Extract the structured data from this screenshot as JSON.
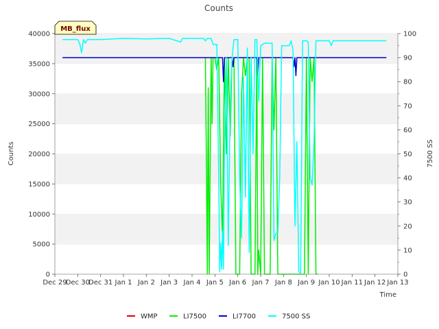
{
  "chart_data": {
    "type": "line",
    "title": "Counts",
    "xlabel": "Time",
    "ylabel": "Counts",
    "ylabel_right": "7500 SS",
    "badge": "MB_flux",
    "x_range": [
      "2023-12-29",
      "2024-01-13"
    ],
    "x_ticks": [
      {
        "date": "2023-12-29",
        "label": "Dec 29"
      },
      {
        "date": "2023-12-30",
        "label": "Dec 30"
      },
      {
        "date": "2023-12-31",
        "label": "Dec 31"
      },
      {
        "date": "2024-01-01",
        "label": "Jan 1"
      },
      {
        "date": "2024-01-02",
        "label": "Jan 2"
      },
      {
        "date": "2024-01-03",
        "label": "Jan 3"
      },
      {
        "date": "2024-01-04",
        "label": "Jan 4"
      },
      {
        "date": "2024-01-05",
        "label": "Jan 5"
      },
      {
        "date": "2024-01-06",
        "label": "Jan 6"
      },
      {
        "date": "2024-01-07",
        "label": "Jan 7"
      },
      {
        "date": "2024-01-08",
        "label": "Jan 8"
      },
      {
        "date": "2024-01-09",
        "label": "Jan 9"
      },
      {
        "date": "2024-01-10",
        "label": "Jan 10"
      },
      {
        "date": "2024-01-11",
        "label": "Jan 11"
      },
      {
        "date": "2024-01-12",
        "label": "Jan 12"
      },
      {
        "date": "2024-01-13",
        "label": "Jan 13"
      }
    ],
    "ylim": [
      0,
      40000
    ],
    "y_ticks": [
      0,
      5000,
      10000,
      15000,
      20000,
      25000,
      30000,
      35000,
      40000
    ],
    "ylim_right": [
      0,
      100
    ],
    "y_ticks_right": [
      0,
      10,
      20,
      30,
      40,
      50,
      60,
      70,
      80,
      90,
      100
    ],
    "grid": "horizontal bands",
    "legend_position": "bottom",
    "series": [
      {
        "name": "WMP",
        "color": "#dd0000",
        "axis": "left",
        "points": []
      },
      {
        "name": "LI7500",
        "color": "#00ee00",
        "axis": "left",
        "points": [
          [
            "2024-01-04 14:00",
            36000
          ],
          [
            "2024-01-04 15:00",
            20000
          ],
          [
            "2024-01-04 16:00",
            0
          ],
          [
            "2024-01-04 17:00",
            31000
          ],
          [
            "2024-01-04 18:00",
            0
          ],
          [
            "2024-01-04 20:00",
            36000
          ],
          [
            "2024-01-04 21:00",
            25000
          ],
          [
            "2024-01-04 22:00",
            36000
          ],
          [
            "2024-01-05 00:00",
            36000
          ],
          [
            "2024-01-05 02:00",
            34000
          ],
          [
            "2024-01-05 04:00",
            36000
          ],
          [
            "2024-01-05 06:00",
            15000
          ],
          [
            "2024-01-05 08:00",
            6000
          ],
          [
            "2024-01-05 10:00",
            36000
          ],
          [
            "2024-01-05 12:00",
            20000
          ],
          [
            "2024-01-05 14:00",
            36000
          ],
          [
            "2024-01-05 16:00",
            23000
          ],
          [
            "2024-01-05 18:00",
            36000
          ],
          [
            "2024-01-05 20:00",
            36000
          ],
          [
            "2024-01-05 22:00",
            0
          ],
          [
            "2024-01-06 00:00",
            0
          ],
          [
            "2024-01-06 02:00",
            0
          ],
          [
            "2024-01-06 04:00",
            30000
          ],
          [
            "2024-01-06 06:00",
            36000
          ],
          [
            "2024-01-06 08:00",
            33000
          ],
          [
            "2024-01-06 10:00",
            36000
          ],
          [
            "2024-01-06 12:00",
            36000
          ],
          [
            "2024-01-06 14:00",
            0
          ],
          [
            "2024-01-06 16:00",
            0
          ],
          [
            "2024-01-06 18:00",
            0
          ],
          [
            "2024-01-06 20:00",
            36000
          ],
          [
            "2024-01-06 21:00",
            0
          ],
          [
            "2024-01-06 22:00",
            4000
          ],
          [
            "2024-01-07 00:00",
            0
          ],
          [
            "2024-01-07 02:00",
            36000
          ],
          [
            "2024-01-07 04:00",
            0
          ],
          [
            "2024-01-07 10:00",
            0
          ],
          [
            "2024-01-07 12:00",
            36000
          ],
          [
            "2024-01-07 14:00",
            24000
          ],
          [
            "2024-01-07 16:00",
            36000
          ],
          [
            "2024-01-07 18:00",
            0
          ],
          [
            "2024-01-08 22:00",
            0
          ],
          [
            "2024-01-09 00:00",
            36000
          ],
          [
            "2024-01-09 02:00",
            0
          ],
          [
            "2024-01-09 04:00",
            36000
          ],
          [
            "2024-01-09 06:00",
            32000
          ],
          [
            "2024-01-09 08:00",
            36000
          ],
          [
            "2024-01-09 10:00",
            0
          ],
          [
            "2024-01-09 12:00",
            0
          ]
        ]
      },
      {
        "name": "LI7700",
        "color": "#0000cc",
        "axis": "left",
        "points": [
          [
            "2023-12-29 08:00",
            36000
          ],
          [
            "2024-01-05 08:00",
            36000
          ],
          [
            "2024-01-05 09:00",
            32000
          ],
          [
            "2024-01-05 10:00",
            36000
          ],
          [
            "2024-01-05 18:00",
            36000
          ],
          [
            "2024-01-05 19:00",
            34500
          ],
          [
            "2024-01-05 20:00",
            36000
          ],
          [
            "2024-01-06 20:00",
            36000
          ],
          [
            "2024-01-06 21:00",
            33000
          ],
          [
            "2024-01-06 22:00",
            36000
          ],
          [
            "2024-01-08 10:00",
            36000
          ],
          [
            "2024-01-08 11:00",
            34500
          ],
          [
            "2024-01-08 12:00",
            36000
          ],
          [
            "2024-01-08 13:00",
            33000
          ],
          [
            "2024-01-08 14:00",
            36000
          ],
          [
            "2024-01-12 12:00",
            36000
          ]
        ]
      },
      {
        "name": "7500 SS",
        "color": "#00ffff",
        "axis": "right",
        "points": [
          [
            "2023-12-29 08:00",
            97.5
          ],
          [
            "2023-12-30 00:00",
            97.5
          ],
          [
            "2023-12-30 02:00",
            96.0
          ],
          [
            "2023-12-30 04:00",
            92.0
          ],
          [
            "2023-12-30 06:00",
            97.5
          ],
          [
            "2023-12-30 08:00",
            96.0
          ],
          [
            "2023-12-30 10:00",
            97.5
          ],
          [
            "2023-12-31 00:00",
            97.5
          ],
          [
            "2024-01-01 00:00",
            98.0
          ],
          [
            "2024-01-02 00:00",
            97.8
          ],
          [
            "2024-01-03 00:00",
            98.0
          ],
          [
            "2024-01-03 12:00",
            96.5
          ],
          [
            "2024-01-03 14:00",
            98.0
          ],
          [
            "2024-01-04 12:00",
            98.0
          ],
          [
            "2024-01-04 14:00",
            97.0
          ],
          [
            "2024-01-04 16:00",
            98.0
          ],
          [
            "2024-01-04 20:00",
            98.0
          ],
          [
            "2024-01-04 22:00",
            95.5
          ],
          [
            "2024-01-05 00:00",
            95.5
          ],
          [
            "2024-01-05 02:00",
            95.5
          ],
          [
            "2024-01-05 04:00",
            40.0
          ],
          [
            "2024-01-05 05:00",
            1.0
          ],
          [
            "2024-01-05 06:00",
            13.0
          ],
          [
            "2024-01-05 07:00",
            2.0
          ],
          [
            "2024-01-05 08:00",
            18.0
          ],
          [
            "2024-01-05 09:00",
            2.0
          ],
          [
            "2024-01-05 10:00",
            50.0
          ],
          [
            "2024-01-05 12:00",
            90.0
          ],
          [
            "2024-01-05 14:00",
            12.0
          ],
          [
            "2024-01-05 16:00",
            70.0
          ],
          [
            "2024-01-05 18:00",
            90.0
          ],
          [
            "2024-01-05 20:00",
            97.5
          ],
          [
            "2024-01-06 00:00",
            97.5
          ],
          [
            "2024-01-06 02:00",
            40.0
          ],
          [
            "2024-01-06 04:00",
            15.0
          ],
          [
            "2024-01-06 06:00",
            82.0
          ],
          [
            "2024-01-06 08:00",
            32.0
          ],
          [
            "2024-01-06 10:00",
            94.0
          ],
          [
            "2024-01-06 12:00",
            9.0
          ],
          [
            "2024-01-06 14:00",
            90.0
          ],
          [
            "2024-01-06 16:00",
            50.0
          ],
          [
            "2024-01-06 18:00",
            97.5
          ],
          [
            "2024-01-06 20:00",
            97.5
          ],
          [
            "2024-01-06 22:00",
            72.0
          ],
          [
            "2024-01-07 00:00",
            95.0
          ],
          [
            "2024-01-07 04:00",
            96.0
          ],
          [
            "2024-01-07 12:00",
            96.0
          ],
          [
            "2024-01-07 14:00",
            14.0
          ],
          [
            "2024-01-07 16:00",
            17.0
          ],
          [
            "2024-01-07 18:00",
            17.0
          ],
          [
            "2024-01-07 20:00",
            40.0
          ],
          [
            "2024-01-07 22:00",
            95.0
          ],
          [
            "2024-01-08 06:00",
            95.0
          ],
          [
            "2024-01-08 08:00",
            97.0
          ],
          [
            "2024-01-08 10:00",
            93.0
          ],
          [
            "2024-01-08 12:00",
            20.0
          ],
          [
            "2024-01-08 14:00",
            55.0
          ],
          [
            "2024-01-08 16:00",
            1.0
          ],
          [
            "2024-01-08 18:00",
            0.5
          ],
          [
            "2024-01-08 20:00",
            97.0
          ],
          [
            "2024-01-09 00:00",
            97.0
          ],
          [
            "2024-01-09 02:00",
            96.5
          ],
          [
            "2024-01-09 04:00",
            40.0
          ],
          [
            "2024-01-09 06:00",
            37.0
          ],
          [
            "2024-01-09 08:00",
            55.0
          ],
          [
            "2024-01-09 10:00",
            97.0
          ],
          [
            "2024-01-10 00:00",
            97.0
          ],
          [
            "2024-01-10 02:00",
            95.0
          ],
          [
            "2024-01-10 04:00",
            97.0
          ],
          [
            "2024-01-12 12:00",
            97.0
          ]
        ]
      }
    ]
  }
}
